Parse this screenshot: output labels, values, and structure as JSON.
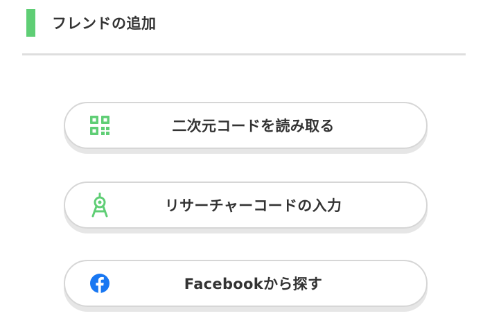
{
  "header": {
    "title": "フレンドの追加"
  },
  "buttons": [
    {
      "label": "二次元コードを読み取る",
      "icon": "qr-code-icon"
    },
    {
      "label": "リサーチャーコードの入力",
      "icon": "compass-icon"
    },
    {
      "label": "Facebookから探す",
      "icon": "facebook-icon"
    }
  ],
  "colors": {
    "accent": "#5fce75",
    "facebook": "#1877f2",
    "text": "#333333",
    "border": "#d6d6d6"
  }
}
